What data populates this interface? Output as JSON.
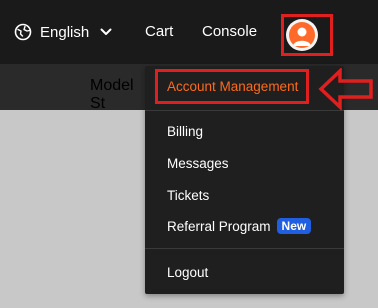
{
  "topbar": {
    "language": "English",
    "language_icon": "globe-icon",
    "cart": "Cart",
    "console": "Console",
    "avatar_icon": "user-avatar-icon"
  },
  "subbar": {
    "label": "Model St"
  },
  "menu": {
    "account_management": "Account Management",
    "billing": "Billing",
    "messages": "Messages",
    "tickets": "Tickets",
    "referral_program": "Referral Program",
    "referral_badge": "New",
    "logout": "Logout"
  },
  "colors": {
    "highlight": "#e01f1f",
    "accent_orange": "#ff6a1a",
    "badge_blue": "#1f5fe0",
    "topbar_bg": "#1a1a1a",
    "menu_bg": "#1f1f1f"
  }
}
